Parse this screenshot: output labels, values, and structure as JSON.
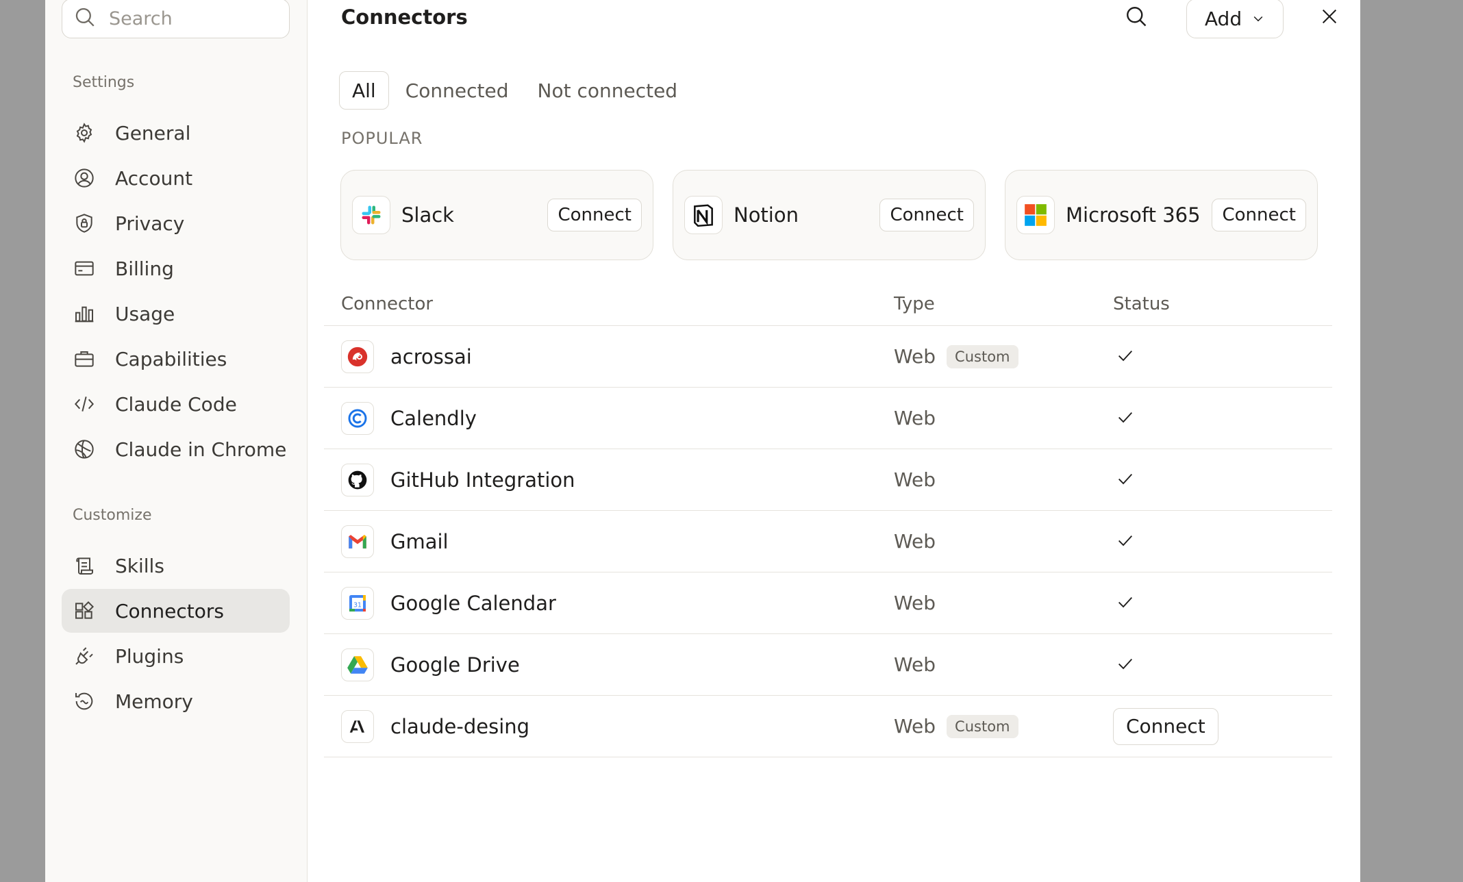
{
  "search": {
    "placeholder": "Search",
    "icon": "search-icon"
  },
  "sidebar": {
    "settings_label": "Settings",
    "settings_items": [
      {
        "label": "General",
        "icon": "gear-icon"
      },
      {
        "label": "Account",
        "icon": "user-circle-icon"
      },
      {
        "label": "Privacy",
        "icon": "shield-lock-icon"
      },
      {
        "label": "Billing",
        "icon": "credit-card-icon"
      },
      {
        "label": "Usage",
        "icon": "bar-chart-icon"
      },
      {
        "label": "Capabilities",
        "icon": "briefcase-icon"
      },
      {
        "label": "Claude Code",
        "icon": "code-icon"
      },
      {
        "label": "Claude in Chrome",
        "icon": "globe-icon"
      }
    ],
    "customize_label": "Customize",
    "customize_items": [
      {
        "label": "Skills",
        "icon": "scroll-icon"
      },
      {
        "label": "Connectors",
        "icon": "grid-plus-icon",
        "active": true
      },
      {
        "label": "Plugins",
        "icon": "plug-icon"
      },
      {
        "label": "Memory",
        "icon": "history-icon"
      }
    ]
  },
  "header": {
    "title": "Connectors",
    "add_label": "Add"
  },
  "tabs": [
    {
      "label": "All",
      "active": true
    },
    {
      "label": "Connected"
    },
    {
      "label": "Not connected"
    }
  ],
  "popular": {
    "label": "POPULAR",
    "cards": [
      {
        "name": "Slack",
        "button": "Connect",
        "icon": "slack-logo-icon"
      },
      {
        "name": "Notion",
        "button": "Connect",
        "icon": "notion-logo-icon"
      },
      {
        "name": "Microsoft 365",
        "button": "Connect",
        "icon": "microsoft-logo-icon"
      }
    ]
  },
  "table": {
    "headers": {
      "connector": "Connector",
      "type": "Type",
      "status": "Status"
    },
    "rows": [
      {
        "name": "acrossai",
        "type": "Web",
        "badge": "Custom",
        "status": "connected",
        "icon": "acrossai-logo-icon"
      },
      {
        "name": "Calendly",
        "type": "Web",
        "badge": "",
        "status": "connected",
        "icon": "calendly-logo-icon"
      },
      {
        "name": "GitHub Integration",
        "type": "Web",
        "badge": "",
        "status": "connected",
        "icon": "github-logo-icon"
      },
      {
        "name": "Gmail",
        "type": "Web",
        "badge": "",
        "status": "connected",
        "icon": "gmail-logo-icon"
      },
      {
        "name": "Google Calendar",
        "type": "Web",
        "badge": "",
        "status": "connected",
        "icon": "google-calendar-logo-icon"
      },
      {
        "name": "Google Drive",
        "type": "Web",
        "badge": "",
        "status": "connected",
        "icon": "google-drive-logo-icon"
      },
      {
        "name": "claude-desing",
        "type": "Web",
        "badge": "Custom",
        "status": "Connect",
        "icon": "anthropic-logo-icon"
      }
    ]
  },
  "colors": {
    "active_nav_bg": "#e8e7e4",
    "sidebar_bg": "#faf9f7",
    "backdrop": "#9b9b9b"
  }
}
